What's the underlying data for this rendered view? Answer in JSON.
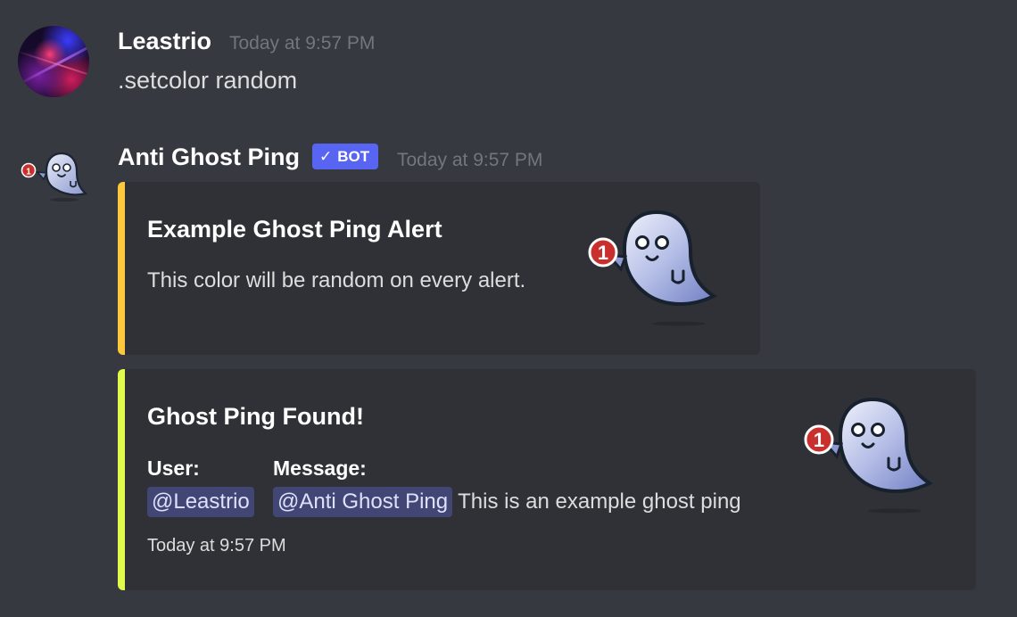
{
  "messages": [
    {
      "author": "Leastrio",
      "timestamp": "Today at 9:57 PM",
      "content": ".setcolor random"
    },
    {
      "author": "Anti Ghost Ping",
      "bot_tag": "BOT",
      "timestamp": "Today at 9:57 PM",
      "embeds": [
        {
          "accent_color": "#fcc83d",
          "title": "Example Ghost Ping Alert",
          "description": "This color will be random on every alert.",
          "thumbnail": "ghost-notification-icon"
        },
        {
          "accent_color": "#e2fa4b",
          "title": "Ghost Ping Found!",
          "fields": [
            {
              "name": "User:",
              "mention": "@Leastrio",
              "text": ""
            },
            {
              "name": "Message:",
              "mention": "@Anti Ghost Ping",
              "text": "This is an example ghost ping"
            }
          ],
          "footer": "Today at 9:57 PM",
          "thumbnail": "ghost-notification-icon"
        }
      ]
    }
  ],
  "avatars": {
    "bot_badge_count": "1"
  }
}
